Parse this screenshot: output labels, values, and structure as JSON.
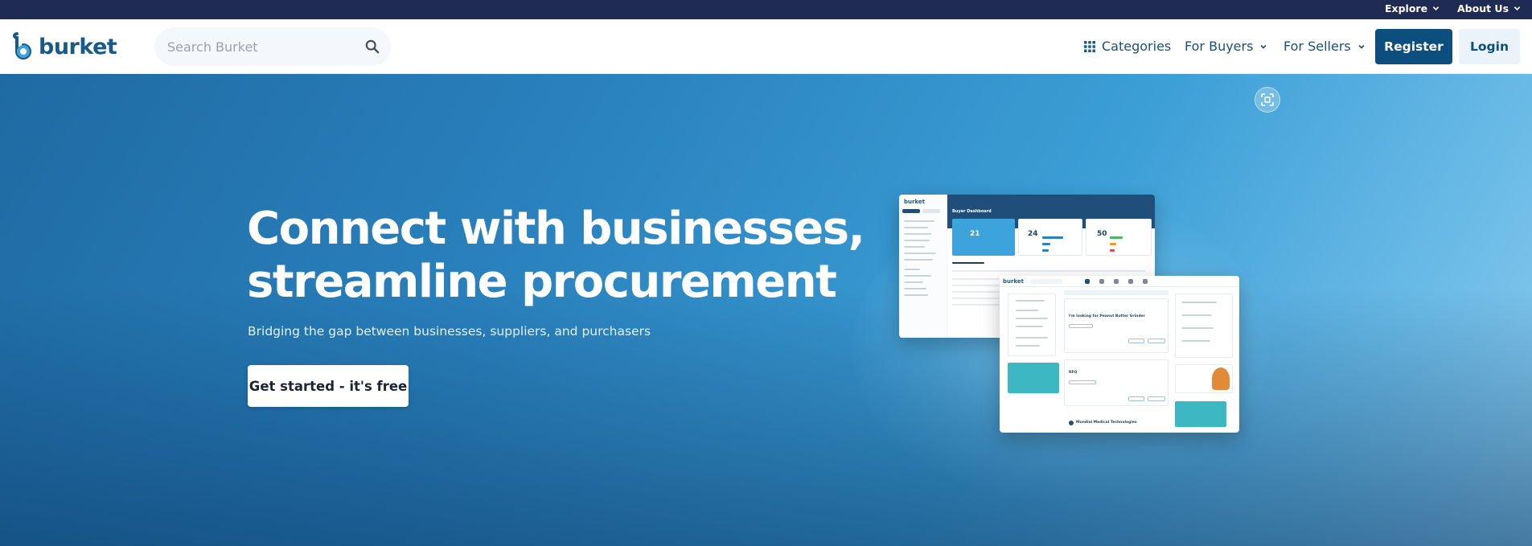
{
  "topbar": {
    "explore_label": "Explore",
    "about_label": "About Us"
  },
  "header": {
    "logo_text": "burket",
    "search_placeholder": "Search Burket",
    "nav": {
      "categories": "Categories",
      "for_buyers": "For Buyers",
      "for_sellers": "For Sellers"
    },
    "register_label": "Register",
    "login_label": "Login"
  },
  "hero": {
    "headline_line1": "Connect with businesses,",
    "headline_line2": "streamline procurement",
    "subline": "Bridging the gap between businesses, suppliers, and purchasers",
    "cta_label": "Get started - it's free"
  },
  "mock_dashboard": {
    "logo_text": "burket",
    "title": "Buyer Dashboard",
    "stat_1": "21",
    "stat_2": "24",
    "stat_3": "50"
  },
  "mock_feed": {
    "logo_text": "burket",
    "post_title": "I'm looking for Peanut Butter Grinder",
    "post_title_2": "RFQ",
    "footer_company": "Mondial Medical Technologies"
  },
  "colors": {
    "topbar": "#1f2b52",
    "brand": "#0c4f7e",
    "hero_start": "#1f6aa3",
    "hero_end": "#8fcdee"
  }
}
